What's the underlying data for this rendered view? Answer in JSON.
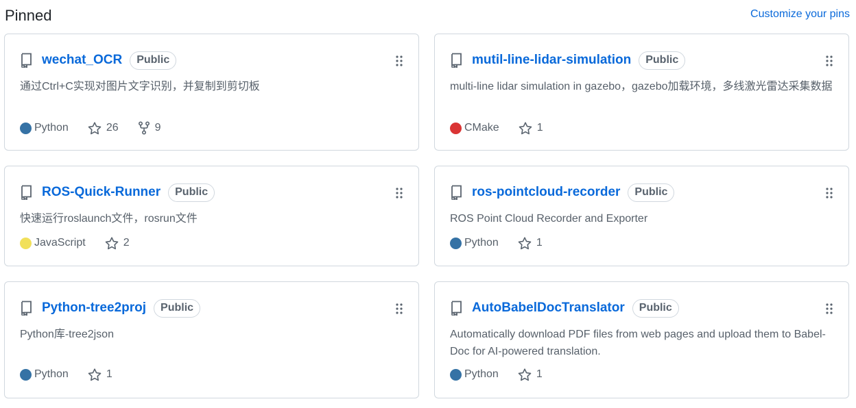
{
  "header": {
    "title": "Pinned",
    "customize_label": "Customize your pins"
  },
  "repos": [
    {
      "name": "wechat_OCR",
      "visibility": "Public",
      "description": "通过Ctrl+C实现对图片文字识别，并复制到剪切板",
      "language": "Python",
      "language_color": "#3572A5",
      "stars": "26",
      "forks": "9"
    },
    {
      "name": "mutil-line-lidar-simulation",
      "visibility": "Public",
      "description": "multi-line lidar simulation in gazebo，gazebo加载环境，多线激光雷达采集数据",
      "language": "CMake",
      "language_color": "#DA3434",
      "stars": "1"
    },
    {
      "name": "ROS-Quick-Runner",
      "visibility": "Public",
      "description": "快速运行roslaunch文件，rosrun文件",
      "language": "JavaScript",
      "language_color": "#f1e05a",
      "stars": "2"
    },
    {
      "name": "ros-pointcloud-recorder",
      "visibility": "Public",
      "description": "ROS Point Cloud Recorder and Exporter",
      "language": "Python",
      "language_color": "#3572A5",
      "stars": "1"
    },
    {
      "name": "Python-tree2proj",
      "visibility": "Public",
      "description": "Python库-tree2json",
      "language": "Python",
      "language_color": "#3572A5",
      "stars": "1"
    },
    {
      "name": "AutoBabelDocTranslator",
      "visibility": "Public",
      "description": "Automatically download PDF files from web pages and upload them to Babel-Doc for AI-powered translation.",
      "language": "Python",
      "language_color": "#3572A5",
      "stars": "1"
    }
  ],
  "icons": {
    "repo": "repo-icon",
    "grip": "grabber-icon",
    "star": "star-icon",
    "fork": "fork-icon"
  }
}
